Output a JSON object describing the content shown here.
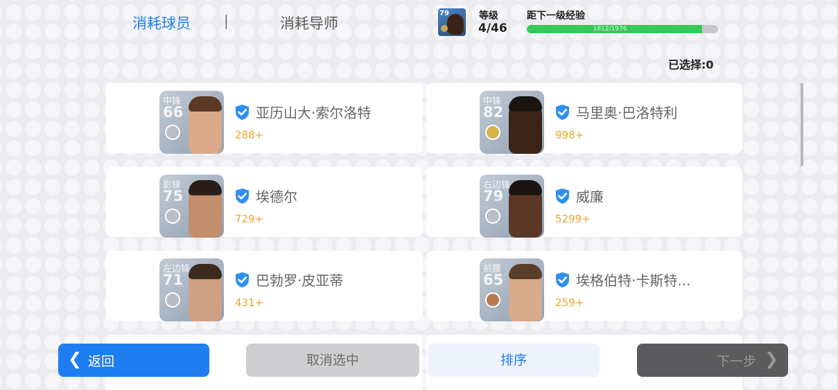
{
  "tabs": {
    "active": "消耗球员",
    "separator": "|",
    "inactive": "消耗导师"
  },
  "header": {
    "avatar_rating": "79",
    "level_label": "等级",
    "level_value": "4/46",
    "exp_label": "距下一级经验",
    "exp_text": "1812/1976",
    "exp_progress": 0.917
  },
  "selected_text": "已选择:0",
  "players": [
    {
      "pos": "中锋",
      "rating": "66",
      "name": "亚历山大·索尔洛特",
      "value": "288+",
      "medal": "silver"
    },
    {
      "pos": "中锋",
      "rating": "82",
      "name": "马里奥·巴洛特利",
      "value": "998+",
      "medal": "gold"
    },
    {
      "pos": "影锋",
      "rating": "75",
      "name": "埃德尔",
      "value": "729+",
      "medal": "silver"
    },
    {
      "pos": "右边锋",
      "rating": "79",
      "name": "威廉",
      "value": "5299+",
      "medal": "silver"
    },
    {
      "pos": "左边锋",
      "rating": "71",
      "name": "巴勃罗·皮亚蒂",
      "value": "431+",
      "medal": "silver"
    },
    {
      "pos": "前腰",
      "rating": "65",
      "name": "埃格伯特·卡斯特...",
      "value": "259+",
      "medal": "bronze"
    }
  ],
  "buttons": {
    "back": "返回",
    "cancel": "取消选中",
    "sort": "排序",
    "next": "下一步"
  },
  "colors": {
    "accent": "#1e7df0",
    "progress": "#36c85a",
    "value": "#e8a52b"
  }
}
